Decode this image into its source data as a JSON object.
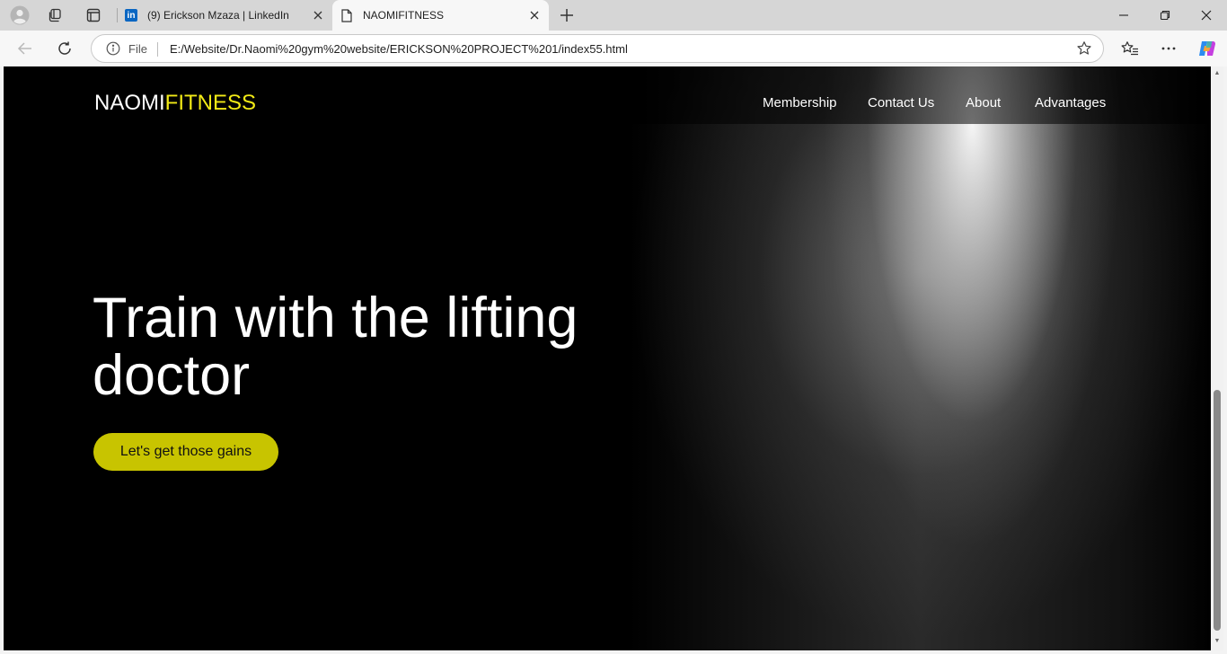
{
  "browser": {
    "tabs": [
      {
        "title": "(9) Erickson Mzaza | LinkedIn",
        "favicon": "linkedin-icon",
        "favicon_text": "in",
        "active": false
      },
      {
        "title": "NAOMIFITNESS",
        "favicon": "document-icon",
        "active": true
      }
    ],
    "address_bar": {
      "scheme_label": "File",
      "url": "E:/Website/Dr.Naomi%20gym%20website/ERICKSON%20PROJECT%201/index55.html"
    },
    "icons": [
      "profile-icon",
      "workspaces-icon",
      "tab-actions-icon",
      "new-tab-icon",
      "minimize-icon",
      "restore-icon",
      "close-icon",
      "back-icon",
      "reload-icon",
      "info-icon",
      "star-icon",
      "favorites-icon",
      "more-icon",
      "copilot-icon"
    ]
  },
  "site": {
    "brand": {
      "part1": "NAOMI",
      "part2": "FITNESS"
    },
    "nav": {
      "membership": "Membership",
      "contact": "Contact Us",
      "about": "About",
      "advantages": "Advantages"
    },
    "hero": {
      "headline": "Train with the lifting doctor",
      "cta": "Let's get those gains"
    },
    "colors": {
      "background": "#000000",
      "brand_accent": "#f2ea16",
      "cta_background": "#c8c400",
      "text": "#ffffff"
    }
  }
}
